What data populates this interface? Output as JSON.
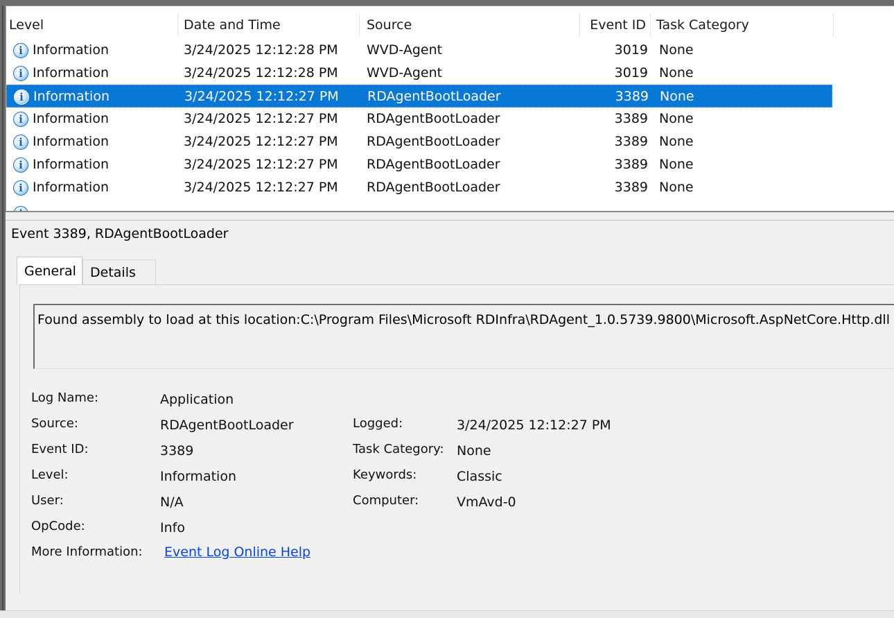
{
  "events": {
    "columns": {
      "level": "Level",
      "date_time": "Date and Time",
      "source": "Source",
      "event_id": "Event ID",
      "task_category": "Task Category"
    },
    "rows": [
      {
        "level": "Information",
        "date_time": "3/24/2025 12:12:28 PM",
        "source": "WVD-Agent",
        "event_id": "3019",
        "task_category": "None",
        "selected": false
      },
      {
        "level": "Information",
        "date_time": "3/24/2025 12:12:28 PM",
        "source": "WVD-Agent",
        "event_id": "3019",
        "task_category": "None",
        "selected": false
      },
      {
        "level": "Information",
        "date_time": "3/24/2025 12:12:27 PM",
        "source": "RDAgentBootLoader",
        "event_id": "3389",
        "task_category": "None",
        "selected": true
      },
      {
        "level": "Information",
        "date_time": "3/24/2025 12:12:27 PM",
        "source": "RDAgentBootLoader",
        "event_id": "3389",
        "task_category": "None",
        "selected": false
      },
      {
        "level": "Information",
        "date_time": "3/24/2025 12:12:27 PM",
        "source": "RDAgentBootLoader",
        "event_id": "3389",
        "task_category": "None",
        "selected": false
      },
      {
        "level": "Information",
        "date_time": "3/24/2025 12:12:27 PM",
        "source": "RDAgentBootLoader",
        "event_id": "3389",
        "task_category": "None",
        "selected": false
      },
      {
        "level": "Information",
        "date_time": "3/24/2025 12:12:27 PM",
        "source": "RDAgentBootLoader",
        "event_id": "3389",
        "task_category": "None",
        "selected": false
      }
    ],
    "icon": "information-icon",
    "selected_color": "#0878d6"
  },
  "detail": {
    "title": "Event 3389, RDAgentBootLoader",
    "tabs": {
      "general": "General",
      "details": "Details"
    },
    "message": "Found assembly to load at this location:C:\\Program Files\\Microsoft RDInfra\\RDAgent_1.0.5739.9800\\Microsoft.AspNetCore.Http.dll",
    "labels": {
      "log_name": "Log Name:",
      "source": "Source:",
      "event_id": "Event ID:",
      "level": "Level:",
      "user": "User:",
      "opcode": "OpCode:",
      "more_info": "More Information:",
      "logged": "Logged:",
      "task_category": "Task Category:",
      "keywords": "Keywords:",
      "computer": "Computer:"
    },
    "values": {
      "log_name": "Application",
      "source": "RDAgentBootLoader",
      "event_id": "3389",
      "level": "Information",
      "user": "N/A",
      "opcode": "Info",
      "more_info_link": "Event Log Online Help",
      "logged": "3/24/2025 12:12:27 PM",
      "task_category": "None",
      "keywords": "Classic",
      "computer": "VmAvd-0"
    }
  }
}
